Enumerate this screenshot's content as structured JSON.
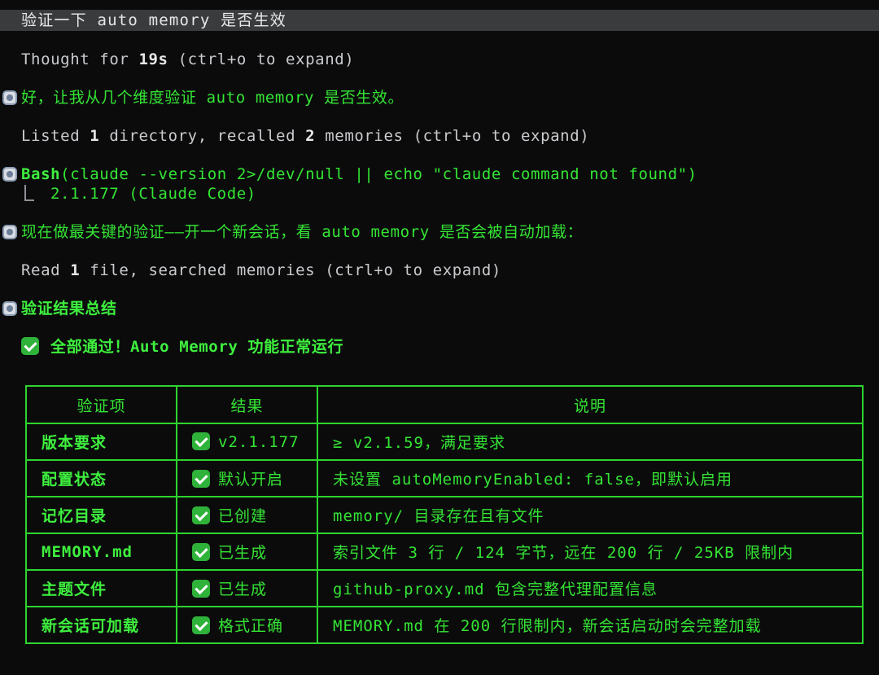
{
  "prompt": {
    "text": "验证一下 auto memory 是否生效"
  },
  "thought": {
    "prefix": "Thought for ",
    "duration": "19s",
    "suffix": " (ctrl+o to expand)"
  },
  "message_1": "好，让我从几个维度验证 auto memory 是否生效。",
  "listed": {
    "t1": "Listed ",
    "n1": "1",
    "t2": " directory, recalled ",
    "n2": "2",
    "t3": " memories (ctrl+o to expand)"
  },
  "bash": {
    "tool": "Bash",
    "command": "(claude --version 2>/dev/null || echo \"claude command not found\")",
    "output": "2.1.177 (Claude Code)"
  },
  "message_2": "现在做最关键的验证——开一个新会话，看 auto memory 是否会被自动加载：",
  "read": {
    "t1": "Read ",
    "n1": "1",
    "t2": " file, searched memories (ctrl+o to expand)"
  },
  "summary": {
    "title": "验证结果总结",
    "headline": "全部通过！Auto Memory 功能正常运行"
  },
  "table": {
    "headers": [
      "验证项",
      "结果",
      "说明"
    ],
    "rows": [
      {
        "item": "版本要求",
        "result": "v2.1.177",
        "desc": "≥ v2.1.59，满足要求"
      },
      {
        "item": "配置状态",
        "result": "默认开启",
        "desc": "未设置 autoMemoryEnabled: false，即默认启用"
      },
      {
        "item": "记忆目录",
        "result": "已创建",
        "desc": "memory/ 目录存在且有文件"
      },
      {
        "item": "MEMORY.md",
        "result": "已生成",
        "desc": "索引文件 3 行 / 124 字节，远在 200 行 / 25KB 限制内"
      },
      {
        "item": "主题文件",
        "result": "已生成",
        "desc": "github-proxy.md 包含完整代理配置信息"
      },
      {
        "item": "新会话可加载",
        "result": "格式正确",
        "desc": "MEMORY.md 在 200 行限制内，新会话启动时会完整加载"
      }
    ]
  },
  "colors": {
    "background": "#0b0b0c",
    "accent_green": "#34e534",
    "prompt_bar": "#3a3b3d"
  }
}
